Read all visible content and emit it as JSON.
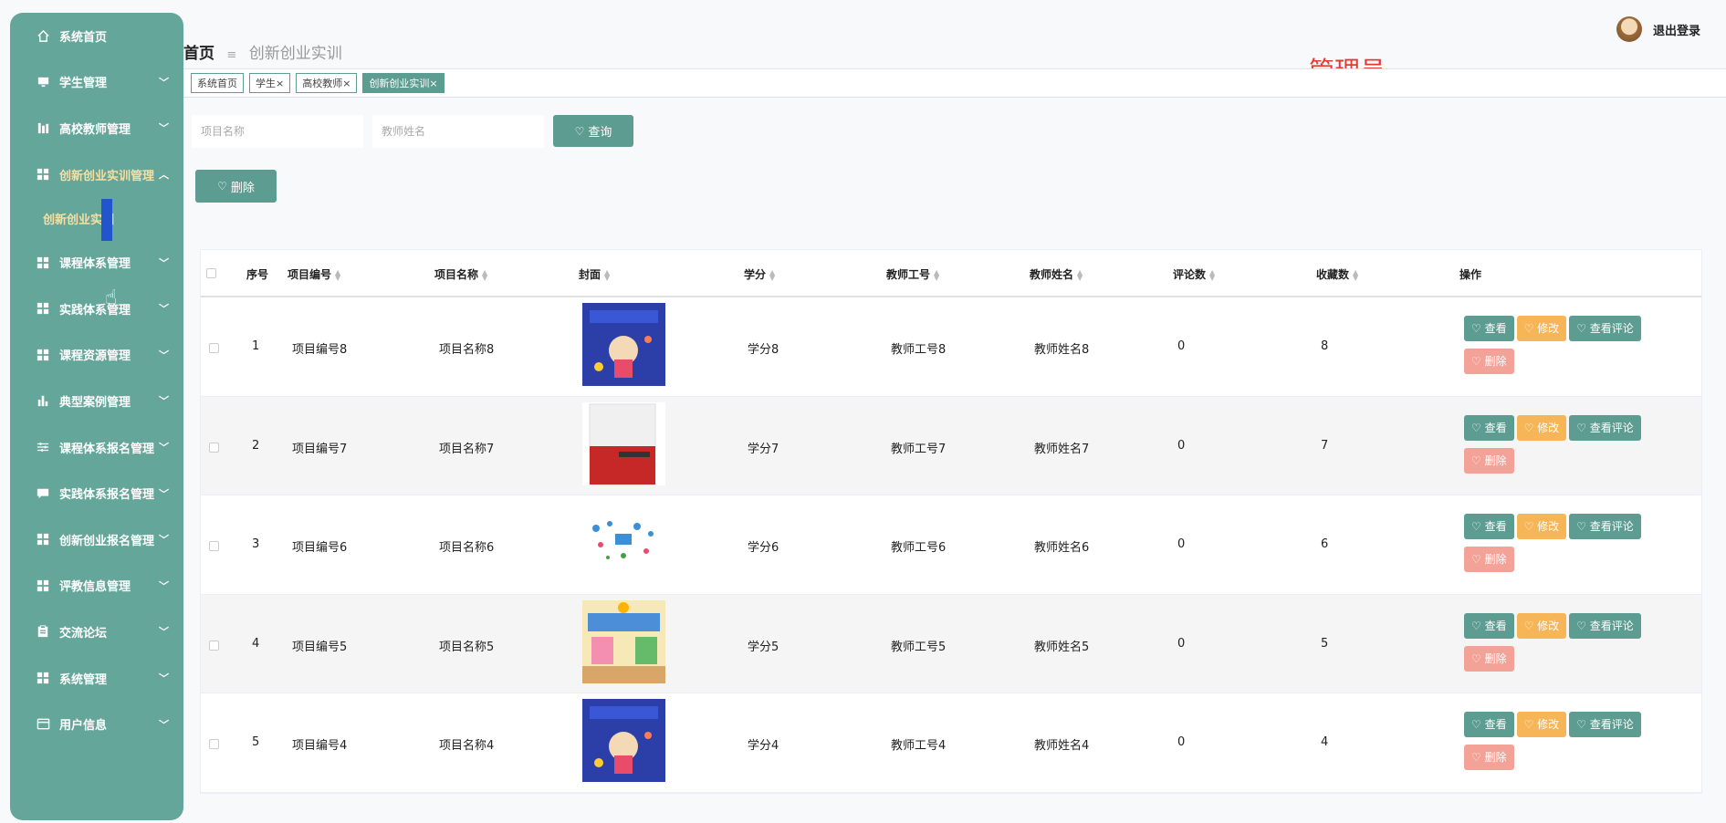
{
  "sidebar": {
    "items": [
      {
        "label": "系统首页",
        "icon": "home-icon",
        "expandable": false
      },
      {
        "label": "学生管理",
        "icon": "monitor-icon",
        "expandable": true
      },
      {
        "label": "高校教师管理",
        "icon": "bars-icon",
        "expandable": true
      },
      {
        "label": "创新创业实训管理",
        "icon": "grid-icon",
        "expandable": true,
        "active": true
      },
      {
        "label": "课程体系管理",
        "icon": "grid-icon",
        "expandable": true
      },
      {
        "label": "实践体系管理",
        "icon": "grid-icon",
        "expandable": true
      },
      {
        "label": "课程资源管理",
        "icon": "grid-icon",
        "expandable": true
      },
      {
        "label": "典型案例管理",
        "icon": "chart-icon",
        "expandable": true
      },
      {
        "label": "课程体系报名管理",
        "icon": "sliders-icon",
        "expandable": true
      },
      {
        "label": "实践体系报名管理",
        "icon": "comment-icon",
        "expandable": true
      },
      {
        "label": "创新创业报名管理",
        "icon": "grid-icon",
        "expandable": true
      },
      {
        "label": "评教信息管理",
        "icon": "grid-icon",
        "expandable": true
      },
      {
        "label": "交流论坛",
        "icon": "clipboard-icon",
        "expandable": true
      },
      {
        "label": "系统管理",
        "icon": "grid-icon",
        "expandable": true
      },
      {
        "label": "用户信息",
        "icon": "card-icon",
        "expandable": true
      }
    ],
    "sub_item": "创新创业实训"
  },
  "header": {
    "breadcrumb_home": "首页",
    "breadcrumb_sep": "≡",
    "breadcrumb_current": "创新创业实训",
    "logout": "退出登录",
    "role": "管理员"
  },
  "tags": [
    {
      "label": "系统首页",
      "active": false
    },
    {
      "label": "学生×",
      "active": false
    },
    {
      "label": "高校教师×",
      "active": false
    },
    {
      "label": "创新创业实训×",
      "active": true
    }
  ],
  "search": {
    "project_name_placeholder": "项目名称",
    "teacher_name_placeholder": "教师姓名",
    "query_label": "查询"
  },
  "delete_label": "删除",
  "table": {
    "columns": [
      "序号",
      "项目编号",
      "项目名称",
      "封面",
      "学分",
      "教师工号",
      "教师姓名",
      "评论数",
      "收藏数",
      "操作"
    ],
    "rows": [
      {
        "no": "1",
        "code": "项目编号8",
        "name": "项目名称8",
        "credit": "学分8",
        "tid": "教师工号8",
        "tname": "教师姓名8",
        "comments": "0",
        "favs": "8",
        "cover": "book-blue"
      },
      {
        "no": "2",
        "code": "项目编号7",
        "name": "项目名称7",
        "credit": "学分7",
        "tid": "教师工号7",
        "tname": "教师姓名7",
        "comments": "0",
        "favs": "7",
        "cover": "book-red"
      },
      {
        "no": "3",
        "code": "项目编号6",
        "name": "项目名称6",
        "credit": "学分6",
        "tid": "教师工号6",
        "tname": "教师姓名6",
        "comments": "0",
        "favs": "6",
        "cover": "icons"
      },
      {
        "no": "4",
        "code": "项目编号5",
        "name": "项目名称5",
        "credit": "学分5",
        "tid": "教师工号5",
        "tname": "教师姓名5",
        "comments": "0",
        "favs": "5",
        "cover": "book-yellow"
      },
      {
        "no": "5",
        "code": "项目编号4",
        "name": "项目名称4",
        "credit": "学分4",
        "tid": "教师工号4",
        "tname": "教师姓名4",
        "comments": "0",
        "favs": "4",
        "cover": "book-blue"
      }
    ],
    "actions": {
      "view": "查看",
      "edit": "修改",
      "view_comments": "查看评论",
      "remove": "删除"
    }
  },
  "colors": {
    "primary": "#5d9c90",
    "sidebar": "#64a69a",
    "warning": "#f6b557",
    "danger": "#f3a298",
    "role": "#e53935"
  }
}
